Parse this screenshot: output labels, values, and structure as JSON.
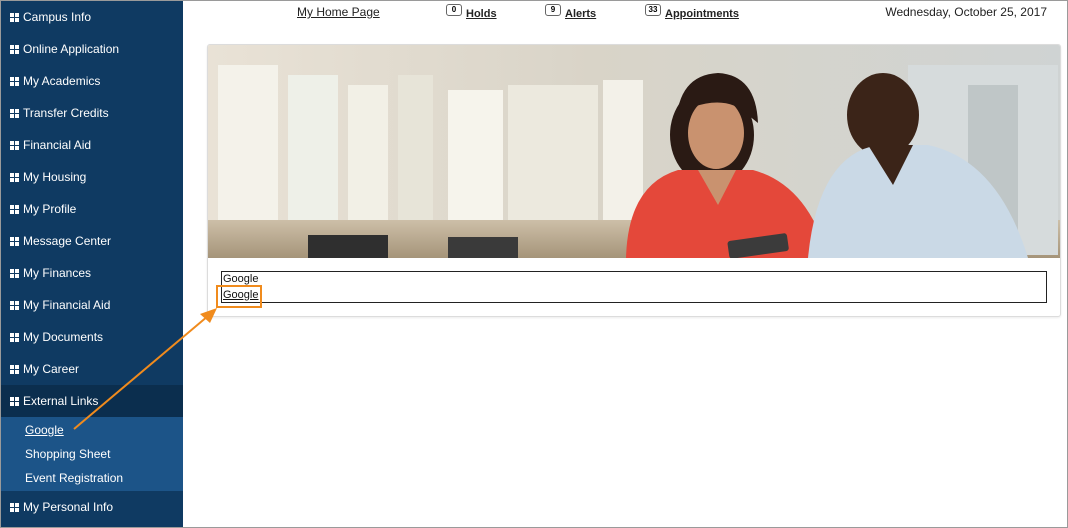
{
  "sidebar": {
    "items": [
      {
        "label": "Campus Info"
      },
      {
        "label": "Online Application"
      },
      {
        "label": "My Academics"
      },
      {
        "label": "Transfer Credits"
      },
      {
        "label": "Financial Aid"
      },
      {
        "label": "My Housing"
      },
      {
        "label": "My Profile"
      },
      {
        "label": "Message Center"
      },
      {
        "label": "My Finances"
      },
      {
        "label": "My Financial Aid"
      },
      {
        "label": "My Documents"
      },
      {
        "label": "My Career"
      },
      {
        "label": "External Links"
      }
    ],
    "external_links": [
      {
        "label": "Google"
      },
      {
        "label": "Shopping Sheet"
      },
      {
        "label": "Event Registration"
      }
    ],
    "last_item": {
      "label": "My Personal Info"
    }
  },
  "topbar": {
    "home_link": "My Home Page",
    "holds": {
      "count": "0",
      "label": "Holds"
    },
    "alerts": {
      "count": "9",
      "label": "Alerts"
    },
    "appointments": {
      "count": "33",
      "label": "Appointments"
    },
    "date": "Wednesday, October 25, 2017"
  },
  "content": {
    "links_heading": "Google",
    "links_google": "Google"
  },
  "colors": {
    "sidebar_bg": "#0f3a62",
    "submenu_bg": "#1c5488",
    "annotation": "#f08b1d"
  }
}
